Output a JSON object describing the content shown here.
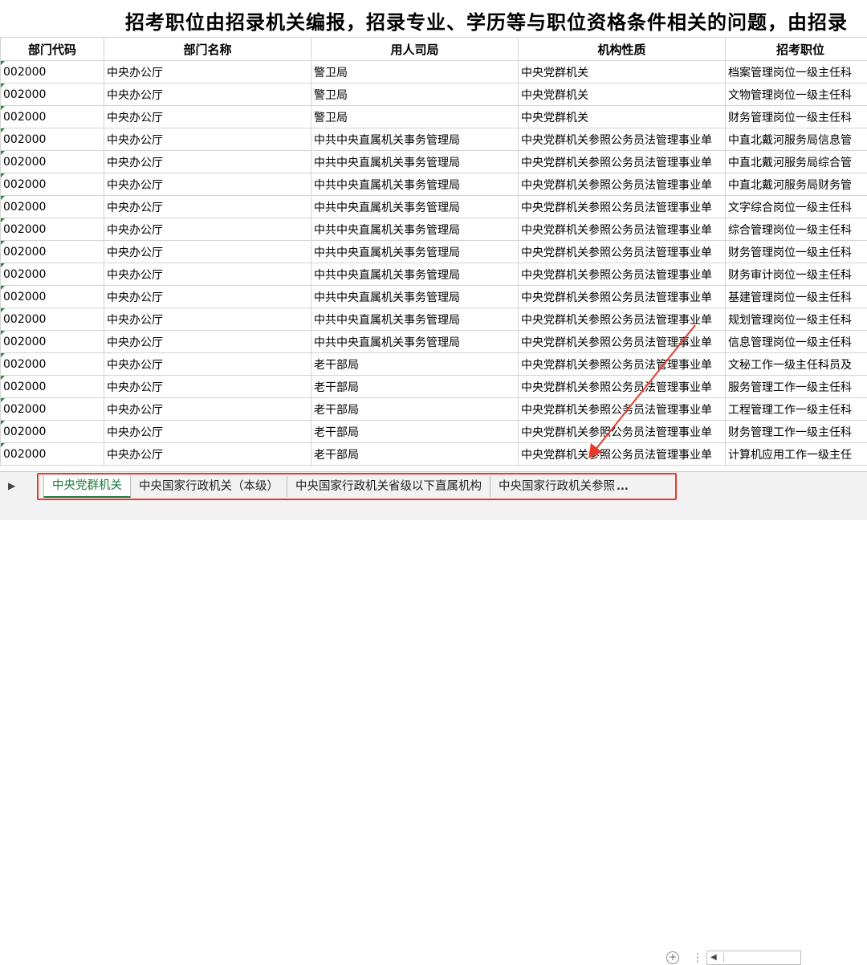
{
  "title": "招考职位由招录机关编报，招录专业、学历等与职位资格条件相关的问题，由招录",
  "headers": [
    "部门代码",
    "部门名称",
    "用人司局",
    "机构性质",
    "招考职位"
  ],
  "rows": [
    [
      "002000",
      "中央办公厅",
      "警卫局",
      "中央党群机关",
      "档案管理岗位一级主任科"
    ],
    [
      "002000",
      "中央办公厅",
      "警卫局",
      "中央党群机关",
      "文物管理岗位一级主任科"
    ],
    [
      "002000",
      "中央办公厅",
      "警卫局",
      "中央党群机关",
      "财务管理岗位一级主任科"
    ],
    [
      "002000",
      "中央办公厅",
      "中共中央直属机关事务管理局",
      "中央党群机关参照公务员法管理事业单",
      "中直北戴河服务局信息管"
    ],
    [
      "002000",
      "中央办公厅",
      "中共中央直属机关事务管理局",
      "中央党群机关参照公务员法管理事业单",
      "中直北戴河服务局综合管"
    ],
    [
      "002000",
      "中央办公厅",
      "中共中央直属机关事务管理局",
      "中央党群机关参照公务员法管理事业单",
      "中直北戴河服务局财务管"
    ],
    [
      "002000",
      "中央办公厅",
      "中共中央直属机关事务管理局",
      "中央党群机关参照公务员法管理事业单",
      "文字综合岗位一级主任科"
    ],
    [
      "002000",
      "中央办公厅",
      "中共中央直属机关事务管理局",
      "中央党群机关参照公务员法管理事业单",
      "综合管理岗位一级主任科"
    ],
    [
      "002000",
      "中央办公厅",
      "中共中央直属机关事务管理局",
      "中央党群机关参照公务员法管理事业单",
      "财务管理岗位一级主任科"
    ],
    [
      "002000",
      "中央办公厅",
      "中共中央直属机关事务管理局",
      "中央党群机关参照公务员法管理事业单",
      "财务审计岗位一级主任科"
    ],
    [
      "002000",
      "中央办公厅",
      "中共中央直属机关事务管理局",
      "中央党群机关参照公务员法管理事业单",
      "基建管理岗位一级主任科"
    ],
    [
      "002000",
      "中央办公厅",
      "中共中央直属机关事务管理局",
      "中央党群机关参照公务员法管理事业单",
      "规划管理岗位一级主任科"
    ],
    [
      "002000",
      "中央办公厅",
      "中共中央直属机关事务管理局",
      "中央党群机关参照公务员法管理事业单",
      "信息管理岗位一级主任科"
    ],
    [
      "002000",
      "中央办公厅",
      "老干部局",
      "中央党群机关参照公务员法管理事业单",
      "文秘工作一级主任科员及"
    ],
    [
      "002000",
      "中央办公厅",
      "老干部局",
      "中央党群机关参照公务员法管理事业单",
      "服务管理工作一级主任科"
    ],
    [
      "002000",
      "中央办公厅",
      "老干部局",
      "中央党群机关参照公务员法管理事业单",
      "工程管理工作一级主任科"
    ],
    [
      "002000",
      "中央办公厅",
      "老干部局",
      "中央党群机关参照公务员法管理事业单",
      "财务管理工作一级主任科"
    ],
    [
      "002000",
      "中央办公厅",
      "老干部局",
      "中央党群机关参照公务员法管理事业单",
      "计算机应用工作一级主任"
    ]
  ],
  "sheet_tabs": [
    "中央党群机关",
    "中央国家行政机关（本级）",
    "中央国家行政机关省级以下直属机构",
    "中央国家行政机关参照"
  ],
  "tab_more": "...",
  "active_tab_index": 0,
  "colors": {
    "accent_green": "#1e7a3c",
    "highlight_red": "#e53b2c"
  }
}
